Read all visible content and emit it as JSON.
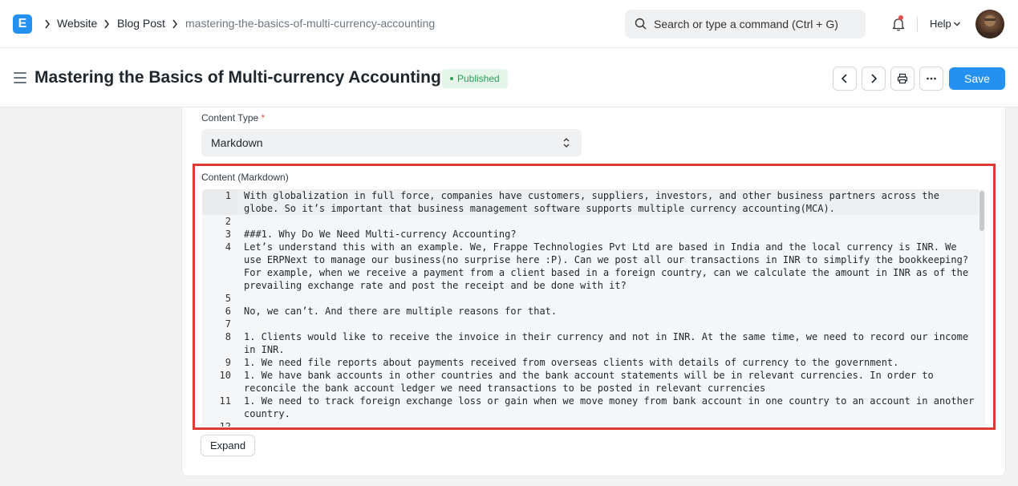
{
  "navbar": {
    "logo_letter": "E",
    "breadcrumbs": [
      "Website",
      "Blog Post",
      "mastering-the-basics-of-multi-currency-accounting"
    ],
    "search_placeholder": "Search or type a command (Ctrl + G)",
    "help_label": "Help"
  },
  "page": {
    "title": "Mastering the Basics of Multi-currency Accounting",
    "status": "Published",
    "status_color": "#2f9d58",
    "save_label": "Save",
    "accent_color": "#2490ef"
  },
  "form": {
    "content_type_label": "Content Type",
    "required_mark": "*",
    "content_type_value": "Markdown",
    "content_label": "Content (Markdown)",
    "expand_label": "Expand",
    "highlight_color": "#dd3b34"
  },
  "editor": {
    "line_numbers": [
      "1",
      "2",
      "3",
      "4",
      "5",
      "6",
      "7",
      "8",
      "9",
      "10",
      "11",
      "12"
    ],
    "rows": [
      "With globalization in full force, companies have customers, suppliers, investors, and other business partners across the",
      "globe. So it’s important that business management software supports multiple currency accounting(MCA).",
      "",
      "###1. Why Do We Need Multi-currency Accounting?",
      "Let’s understand this with an example. We, Frappe Technologies Pvt Ltd are based in India and the local currency is INR. We",
      "use ERPNext to manage our business(no surprise here :P). Can we post all our transactions in INR to simplify the bookkeeping?",
      "For example, when we receive a payment from a client based in a foreign country, can we calculate the amount in INR as of the",
      "prevailing exchange rate and post the receipt and be done with it?",
      "",
      "No, we can’t. And there are multiple reasons for that.",
      "",
      "1. Clients would like to receive the invoice in their currency and not in INR. At the same time, we need to record our income",
      "in INR.",
      "1. We need file reports about payments received from overseas clients with details of currency to the government.",
      "1. We have bank accounts in other countries and the bank account statements will be in relevant currencies. In order to",
      "reconcile the bank account ledger we need transactions to be posted in relevant currencies",
      "1. We need to track foreign exchange loss or gain when we move money from bank account in one country to an account in another",
      "country.",
      ""
    ]
  }
}
